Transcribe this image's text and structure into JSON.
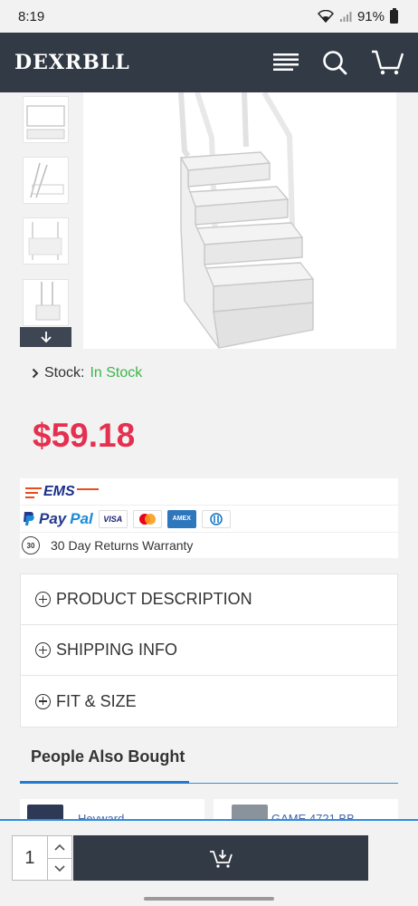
{
  "status_bar": {
    "time": "8:19",
    "battery": "91%"
  },
  "header": {
    "logo": "DEXRBLL",
    "icons": [
      "menu-icon",
      "search-icon",
      "cart-icon"
    ]
  },
  "gallery": {
    "thumbnail_count": 4,
    "scroll_icon": "arrow-down-icon"
  },
  "product": {
    "stock_label": "Stock:",
    "stock_value": "In Stock",
    "price": "$59.18"
  },
  "shipping": {
    "carrier": "EMS",
    "payment_brand_pay": "Pay",
    "payment_brand_pal": "Pal",
    "cards": [
      "VISA",
      "MC",
      "AMEX",
      "DC"
    ],
    "returns_badge": "30",
    "returns_text": "30 Day Returns Warranty"
  },
  "accordion": [
    {
      "label": "PRODUCT DESCRIPTION"
    },
    {
      "label": "SHIPPING INFO"
    },
    {
      "label": "FIT & SIZE"
    }
  ],
  "people_also_bought": {
    "title": "People Also Bought",
    "items": [
      {
        "name": "Heyward"
      },
      {
        "name": "GAME 4721 BB"
      }
    ]
  },
  "bottom_bar": {
    "quantity": "1"
  },
  "colors": {
    "header_bg": "#323a45",
    "price": "#e5304f",
    "in_stock": "#3cb54a",
    "accent_line": "#2d8ee0"
  }
}
